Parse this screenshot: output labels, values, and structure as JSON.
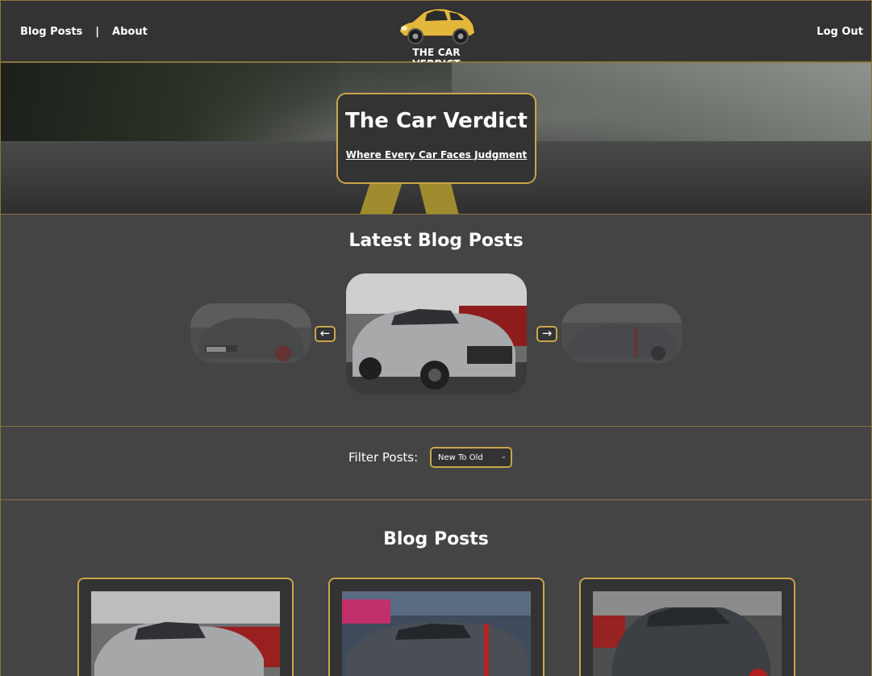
{
  "header": {
    "nav": [
      "Blog Posts",
      "|",
      "About"
    ],
    "logo_text": "THE CAR VERDICT",
    "logout": "Log Out"
  },
  "hero": {
    "title": "The Car Verdict",
    "subtitle": "Where Every Car Faces Judgment"
  },
  "latest": {
    "title": "Latest Blog Posts",
    "prev_arrow": "←",
    "next_arrow": "→"
  },
  "filter": {
    "label": "Filter Posts:",
    "selected": "New To Old"
  },
  "posts": {
    "title": "Blog Posts"
  },
  "colors": {
    "accent": "#c9a64a",
    "background": "#444444",
    "panel": "#333333"
  }
}
